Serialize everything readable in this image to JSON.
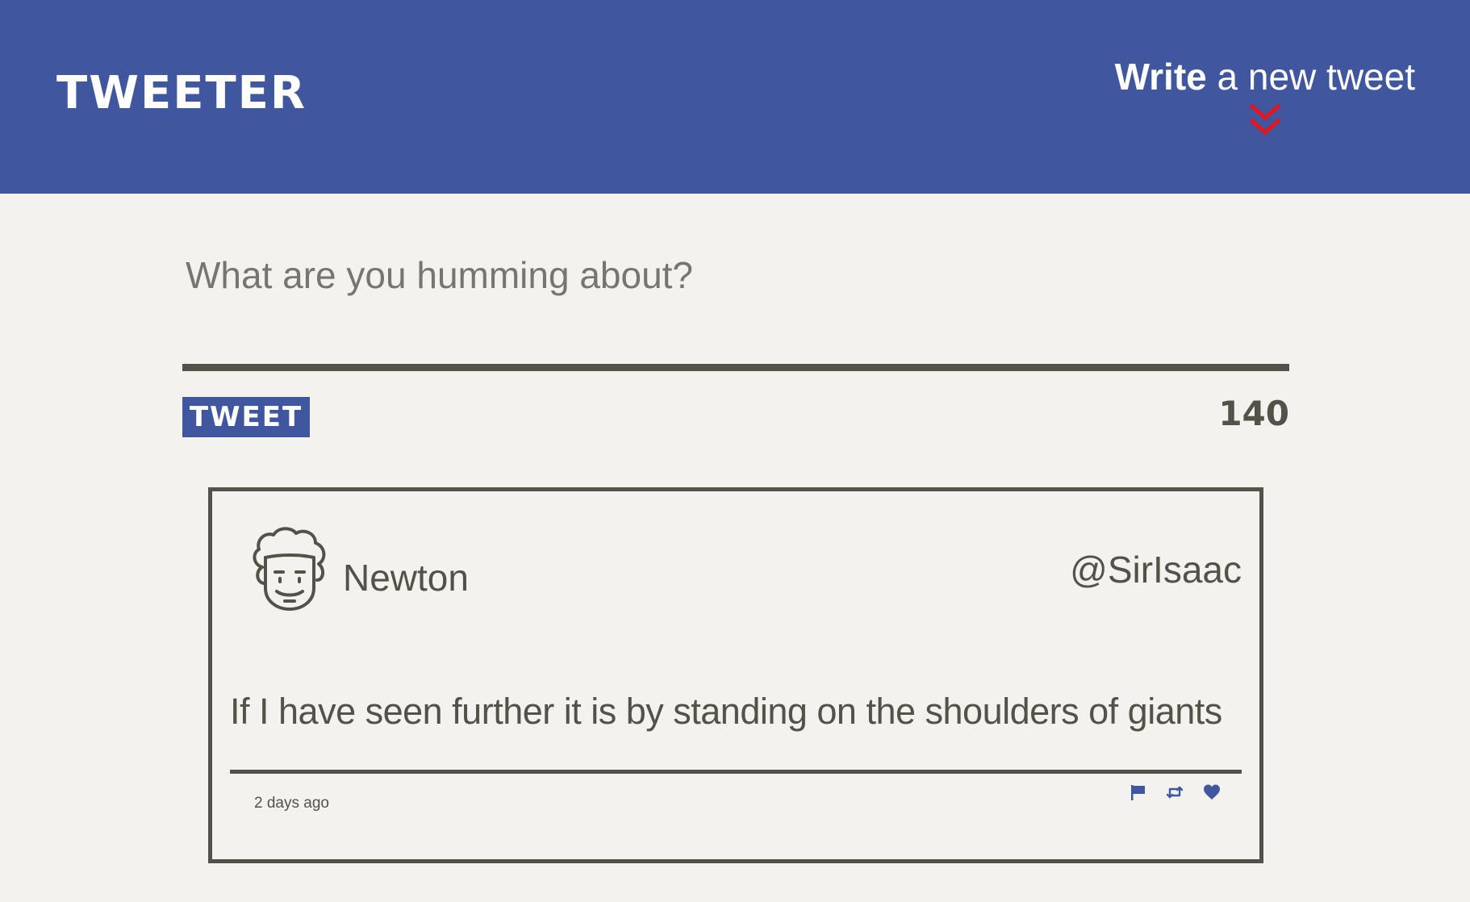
{
  "header": {
    "brand": "TWEETER",
    "compose_link_bold": "Write",
    "compose_link_rest": " a new tweet",
    "chevron_icon": "double-chevron-down-icon",
    "chevron_color": "#e4151b"
  },
  "compose": {
    "placeholder": "What are you humming about?",
    "value": "",
    "button_label": "TWEET",
    "char_count": "140"
  },
  "tweet": {
    "avatar_icon": "face-avatar-icon",
    "author_name": "Newton",
    "author_handle": "@SirIsaac",
    "content": "If I have seen further it is by standing on the shoulders of giants",
    "timestamp": "2 days ago",
    "actions": [
      "flag-icon",
      "retweet-icon",
      "heart-icon"
    ]
  },
  "colors": {
    "brand_blue": "#4057a0",
    "background": "#f3f2ee",
    "text_dark": "#545149",
    "accent_red": "#e4151b"
  }
}
